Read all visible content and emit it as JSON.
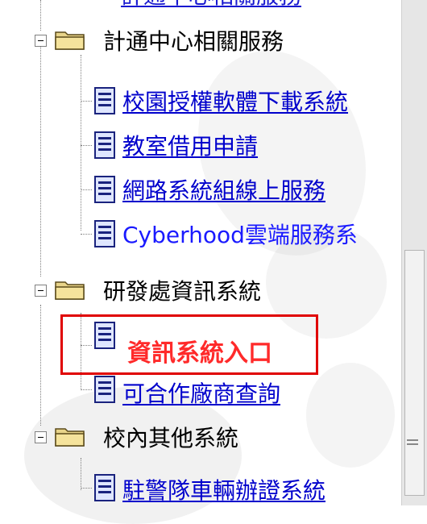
{
  "tree": {
    "top_partial_label": "計通中心相關服務",
    "groups": [
      {
        "label": "計通中心相關服務",
        "items": [
          {
            "label": "校園授權軟體下載系統",
            "type": "link"
          },
          {
            "label": "教室借用申請",
            "type": "link"
          },
          {
            "label": "網路系統組線上服務",
            "type": "link"
          },
          {
            "label": "Cyberhood雲端服務系",
            "type": "plain"
          }
        ]
      },
      {
        "label": "研發處資訊系統",
        "items": [
          {
            "label": "資訊系統入口",
            "type": "highlight"
          },
          {
            "label": "可合作廠商查詢",
            "type": "link"
          }
        ]
      },
      {
        "label": "校內其他系統",
        "items": [
          {
            "label": "駐警隊車輛辦證系統",
            "type": "link"
          }
        ]
      }
    ]
  },
  "icons": {
    "folder": "folder-icon",
    "document": "document-icon",
    "expander": "collapse-minus-icon"
  },
  "colors": {
    "link": "#0000cc",
    "highlight_text": "#ff2a2a",
    "highlight_border": "#e00000",
    "tree_line": "#808080"
  }
}
